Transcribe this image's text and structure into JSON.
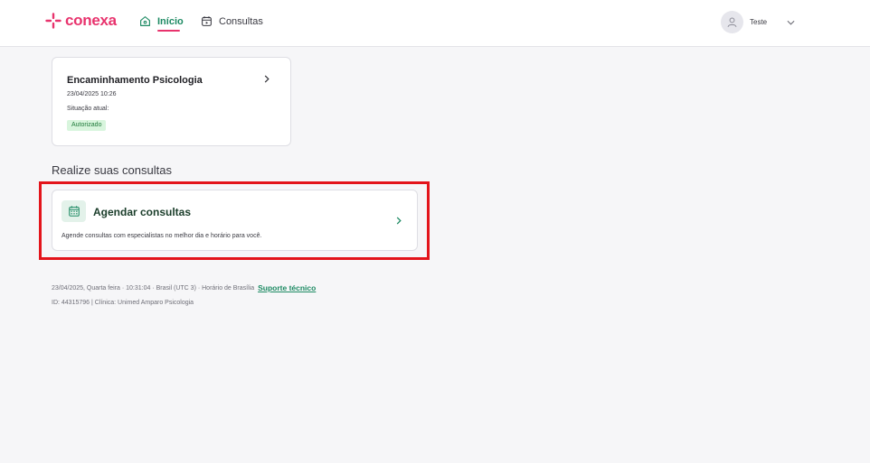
{
  "header": {
    "logo_text": "conexa",
    "nav": [
      {
        "label": "Início",
        "icon": "home-icon",
        "active": true
      },
      {
        "label": "Consultas",
        "icon": "calendar-play-icon",
        "active": false
      }
    ],
    "user": {
      "name": "Teste",
      "icon": "user-icon"
    }
  },
  "encaminhamento": {
    "title": "Encaminhamento Psicologia",
    "date": "23/04/2025 10:26",
    "situation_label": "Situação atual:",
    "status": "Autorizado"
  },
  "section": {
    "title": "Realize suas consultas"
  },
  "agendar": {
    "title": "Agendar consultas",
    "description": "Agende consultas com especialistas no melhor dia e horário para você."
  },
  "footer": {
    "line1": "23/04/2025, Quarta feira · 10:31:04 · Brasil (UTC 3) · Horário de Brasília",
    "support_link": "Suporte técnico",
    "line2": "ID: 44315796 | Clínica: Unimed Amparo Psicologia"
  },
  "colors": {
    "brand": "#e8336d",
    "accent": "#1d8a63",
    "highlight": "#e3141b",
    "status_bg": "#d8f5dd"
  }
}
